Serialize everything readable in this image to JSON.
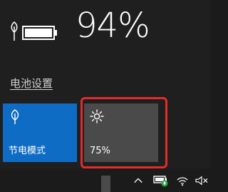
{
  "battery": {
    "percent_text": "94%",
    "level": 0.94
  },
  "settings_link": {
    "label": "电池设置"
  },
  "tiles": [
    {
      "label": "节电模式",
      "icon": "leaf-icon",
      "state": "on",
      "color": "#0f6cc4"
    },
    {
      "label": "75%",
      "icon": "brightness-icon",
      "state": "off",
      "color": "#4a4a4a"
    }
  ],
  "highlight": {
    "color": "#e42b2b"
  },
  "taskbar": {
    "tray_icons": [
      "chevron-up-icon",
      "battery-saver-tray-icon",
      "wifi-icon",
      "speaker-muted-icon"
    ]
  }
}
